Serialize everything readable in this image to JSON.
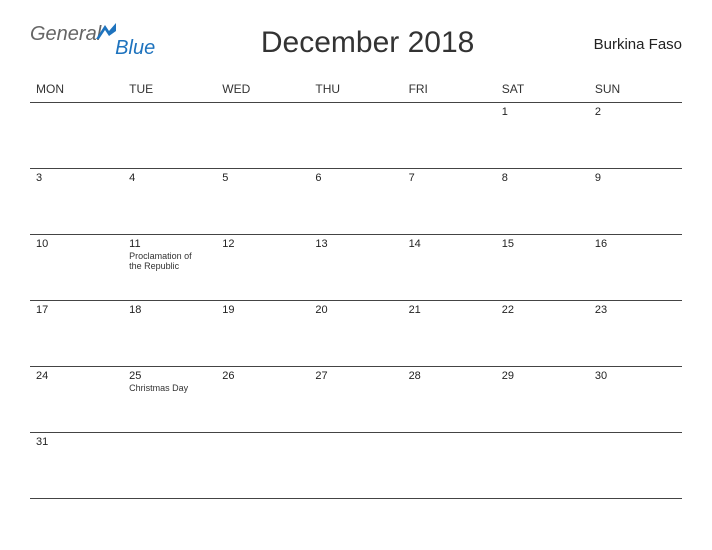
{
  "logo": {
    "word1": "General",
    "word2": "Blue"
  },
  "title": "December 2018",
  "country": "Burkina Faso",
  "dayHeaders": [
    "MON",
    "TUE",
    "WED",
    "THU",
    "FRI",
    "SAT",
    "SUN"
  ],
  "weeks": [
    [
      {
        "n": ""
      },
      {
        "n": ""
      },
      {
        "n": ""
      },
      {
        "n": ""
      },
      {
        "n": ""
      },
      {
        "n": "1"
      },
      {
        "n": "2"
      }
    ],
    [
      {
        "n": "3"
      },
      {
        "n": "4"
      },
      {
        "n": "5"
      },
      {
        "n": "6"
      },
      {
        "n": "7"
      },
      {
        "n": "8"
      },
      {
        "n": "9"
      }
    ],
    [
      {
        "n": "10"
      },
      {
        "n": "11",
        "e": "Proclamation of the Republic"
      },
      {
        "n": "12"
      },
      {
        "n": "13"
      },
      {
        "n": "14"
      },
      {
        "n": "15"
      },
      {
        "n": "16"
      }
    ],
    [
      {
        "n": "17"
      },
      {
        "n": "18"
      },
      {
        "n": "19"
      },
      {
        "n": "20"
      },
      {
        "n": "21"
      },
      {
        "n": "22"
      },
      {
        "n": "23"
      }
    ],
    [
      {
        "n": "24"
      },
      {
        "n": "25",
        "e": "Christmas Day"
      },
      {
        "n": "26"
      },
      {
        "n": "27"
      },
      {
        "n": "28"
      },
      {
        "n": "29"
      },
      {
        "n": "30"
      }
    ],
    [
      {
        "n": "31"
      },
      {
        "n": ""
      },
      {
        "n": ""
      },
      {
        "n": ""
      },
      {
        "n": ""
      },
      {
        "n": ""
      },
      {
        "n": ""
      }
    ]
  ]
}
